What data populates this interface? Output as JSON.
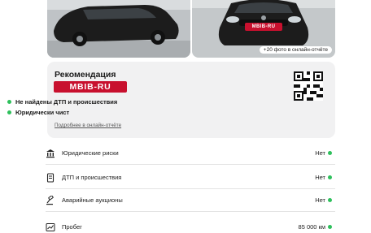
{
  "photos": {
    "more_label": "+20 фото в онлайн-отчёте",
    "plate_text": "MBIB-RU",
    "car_color": "#1c1c1c"
  },
  "recommendation": {
    "title": "Рекомендация",
    "brand": "MBIB-RU",
    "brand_color": "#c8102e",
    "checks": [
      {
        "label": "Не найдены ДТП и происшествия"
      },
      {
        "label": "Юридически чист"
      }
    ],
    "details_link": "Подробнее в онлайн-отчёте",
    "status_color": "#2ec05c"
  },
  "rows": [
    {
      "icon": "bank-icon",
      "label": "Юридические риски",
      "value": "Нет"
    },
    {
      "icon": "document-icon",
      "label": "ДТП и происшествия",
      "value": "Нет"
    },
    {
      "icon": "gavel-icon",
      "label": "Аварийные аукционы",
      "value": "Нет"
    },
    {
      "icon": "chart-icon",
      "label": "Пробег",
      "value": "85 000 км"
    }
  ]
}
